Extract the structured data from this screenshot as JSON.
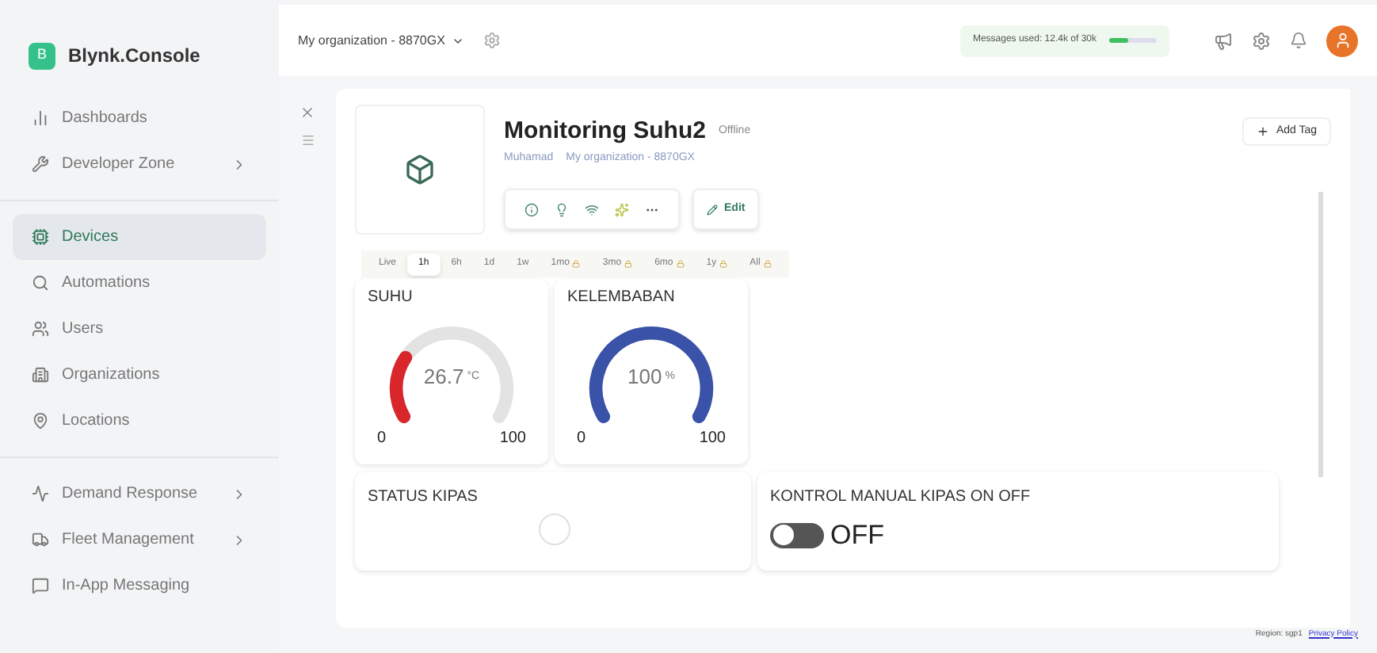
{
  "brand": {
    "logo": "B",
    "name": "Blynk.Console"
  },
  "header": {
    "org": "My organization - 8870GX",
    "messages": "Messages used: 12.4k of 30k"
  },
  "sidebar": {
    "sections": [
      {
        "items": [
          {
            "label": "Dashboards",
            "selected": false,
            "has_children": false
          },
          {
            "label": "Developer Zone",
            "selected": false,
            "has_children": true
          }
        ]
      },
      {
        "items": [
          {
            "label": "Devices",
            "selected": true,
            "has_children": false
          },
          {
            "label": "Automations",
            "selected": false,
            "has_children": false
          },
          {
            "label": "Users",
            "selected": false,
            "has_children": false
          },
          {
            "label": "Organizations",
            "selected": false,
            "has_children": false
          },
          {
            "label": "Locations",
            "selected": false,
            "has_children": false
          }
        ]
      },
      {
        "items": [
          {
            "label": "Demand Response",
            "selected": false,
            "has_children": true
          },
          {
            "label": "Fleet Management",
            "selected": false,
            "has_children": true
          },
          {
            "label": "In-App Messaging",
            "selected": false,
            "has_children": false
          }
        ]
      }
    ]
  },
  "device": {
    "title": "Monitoring Suhu2",
    "status": "Offline",
    "owner": "Muhamad",
    "org": "My organization - 8870GX",
    "edit": "Edit",
    "add_tag": "Add Tag"
  },
  "time_ranges": [
    {
      "label": "Live",
      "selected": false,
      "locked": false
    },
    {
      "label": "1h",
      "selected": true,
      "locked": false
    },
    {
      "label": "6h",
      "selected": false,
      "locked": false
    },
    {
      "label": "1d",
      "selected": false,
      "locked": false
    },
    {
      "label": "1w",
      "selected": false,
      "locked": false
    },
    {
      "label": "1mo",
      "selected": false,
      "locked": true
    },
    {
      "label": "3mo",
      "selected": false,
      "locked": true
    },
    {
      "label": "6mo",
      "selected": false,
      "locked": true
    },
    {
      "label": "1y",
      "selected": false,
      "locked": true
    },
    {
      "label": "All",
      "selected": false,
      "locked": true
    }
  ],
  "widgets": [
    {
      "kind": "gauge",
      "title": "SUHU",
      "value": "26.7",
      "unit": "°C",
      "color": "#d9262b",
      "min": "0",
      "max": "100"
    },
    {
      "kind": "gauge",
      "title": "KELEMBABAN",
      "value": "100",
      "unit": "%",
      "color": "#3a52a8",
      "min": "0",
      "max": "100"
    },
    {
      "kind": "led",
      "title": "STATUS KIPAS",
      "on": false
    },
    {
      "kind": "switch",
      "title": "KONTROL MANUAL KIPAS ON OFF",
      "on": false,
      "state_label": "OFF"
    }
  ],
  "footer": {
    "region": "Region: sgp1",
    "privacy": "Privacy Policy"
  }
}
